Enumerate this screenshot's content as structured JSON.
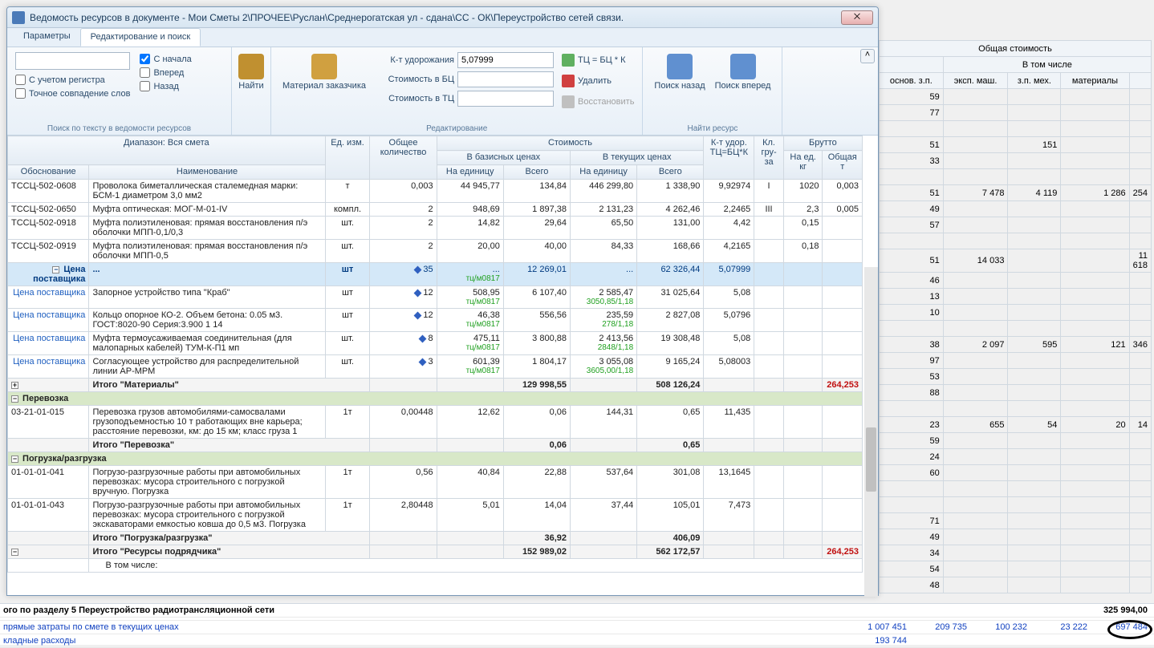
{
  "window": {
    "title": "Ведомость ресурсов в документе - Мои Сметы 2\\ПРОЧЕЕ\\Руслан\\Среднерогатская ул - сдана\\СС - ОК\\Переустройство сетей связи.",
    "close": "⨉"
  },
  "tabs": {
    "params": "Параметры",
    "edit": "Редактирование и поиск"
  },
  "ribbon": {
    "group1": "Поиск по тексту в ведомости ресурсов",
    "chk_register": "С учетом регистра",
    "chk_exact": "Точное совпадение слов",
    "chk_start": "С начала",
    "chk_fwd": "Вперед",
    "chk_back": "Назад",
    "find": "Найти",
    "material": "Материал заказчика",
    "k_label": "К-т удорожания",
    "k_val": "5,07999",
    "cost_bc": "Стоимость в БЦ",
    "cost_tc": "Стоимость в ТЦ",
    "group2": "Редактирование",
    "tcbc": "ТЦ = БЦ * К",
    "delete": "Удалить",
    "restore": "Восстановить",
    "group3": "Найти ресурс",
    "search_back": "Поиск назад",
    "search_fwd": "Поиск вперед"
  },
  "hdr": {
    "range": "Диапазон: Вся смета",
    "obosn": "Обоснование",
    "name": "Наименование",
    "unit": "Ед. изм.",
    "qty": "Общее количество",
    "cost": "Стоимость",
    "base": "В базисных ценах",
    "cur": "В текущих ценах",
    "per": "На единицу",
    "total": "Всего",
    "k": "К-т удор. ТЦ=БЦ*К",
    "class": "Кл. гру-за",
    "brutto": "Брутто",
    "brutto1": "На ед. кг",
    "brutto2": "Общая т"
  },
  "rows": [
    {
      "code": "ТССЦ-502-0608",
      "name": "Проволока биметаллическая сталемедная марки: БСМ-1 диаметром 3,0 мм2",
      "u": "т",
      "q": "0,003",
      "bp": "44 945,77",
      "bt": "134,84",
      "cp": "446 299,80",
      "ct": "1 338,90",
      "k": "9,92974",
      "cl": "I",
      "b1": "1020",
      "b2": "0,003"
    },
    {
      "code": "ТССЦ-502-0650",
      "name": "Муфта оптическая: МОГ-М-01-IV",
      "u": "компл.",
      "q": "2",
      "bp": "948,69",
      "bt": "1 897,38",
      "cp": "2 131,23",
      "ct": "4 262,46",
      "k": "2,2465",
      "cl": "III",
      "b1": "2,3",
      "b2": "0,005"
    },
    {
      "code": "ТССЦ-502-0918",
      "name": "Муфта полиэтиленовая: прямая восстановления п/э оболочки МПП-0,1/0,3",
      "u": "шт.",
      "q": "2",
      "bp": "14,82",
      "bt": "29,64",
      "cp": "65,50",
      "ct": "131,00",
      "k": "4,42",
      "cl": "",
      "b1": "0,15",
      "b2": ""
    },
    {
      "code": "ТССЦ-502-0919",
      "name": "Муфта полиэтиленовая: прямая восстановления п/э оболочки МПП-0,5",
      "u": "шт.",
      "q": "2",
      "bp": "20,00",
      "bt": "40,00",
      "cp": "84,33",
      "ct": "168,66",
      "k": "4,2165",
      "cl": "",
      "b1": "0,18",
      "b2": ""
    },
    {
      "sel": true,
      "code": "Цена поставщика",
      "name": "...",
      "u": "шт",
      "q": "35",
      "bp": "...",
      "bp2": "тц/м0817",
      "bt": "12 269,01",
      "cp": "...",
      "ct": "62 326,44",
      "k": "5,07999"
    },
    {
      "code": "Цена поставщика",
      "name": "Запорное устройство типа \"Краб\"",
      "u": "шт",
      "q": "12",
      "bp": "508,95",
      "bp2": "тц/м0817",
      "bt": "6 107,40",
      "cp": "2 585,47",
      "cp2": "3050,85/1,18",
      "ct": "31 025,64",
      "k": "5,08"
    },
    {
      "code": "Цена поставщика",
      "name": "Кольцо опорное КО-2. Объем бетона: 0.05 м3. ГОСТ:8020-90 Серия:3.900 1 14",
      "u": "шт",
      "q": "12",
      "bp": "46,38",
      "bp2": "тц/м0817",
      "bt": "556,56",
      "cp": "235,59",
      "cp2": "278/1,18",
      "ct": "2 827,08",
      "k": "5,0796"
    },
    {
      "code": "Цена поставщика",
      "name": "Муфта термоусаживаемая соединительная  (для малопарных кабелей) ТУМ-К-П1 мп",
      "u": "шт.",
      "q": "8",
      "bp": "475,11",
      "bp2": "тц/м0817",
      "bt": "3 800,88",
      "cp": "2 413,56",
      "cp2": "2848/1,18",
      "ct": "19 308,48",
      "k": "5,08"
    },
    {
      "code": "Цена поставщика",
      "name": "Согласующее устройство для распределительной линии АР-МРМ",
      "u": "шт.",
      "q": "3",
      "bp": "601,39",
      "bp2": "тц/м0817",
      "bt": "1 804,17",
      "cp": "3 055,08",
      "cp2": "3605,00/1,18",
      "ct": "9 165,24",
      "k": "5,08003"
    }
  ],
  "totals": {
    "mat": "Итого \"Материалы\"",
    "mat_bt": "129 998,55",
    "mat_ct": "508 126,24",
    "mat_b2": "264,253",
    "perev": "Перевозка",
    "r1_code": "03-21-01-015",
    "r1_name": "Перевозка грузов автомобилями-самосвалами грузоподъемностью 10 т работающих вне карьера; расстояние перевозки, км: до 15 км; класс груза 1",
    "r1_u": "1т",
    "r1_q": "0,00448",
    "r1_bp": "12,62",
    "r1_bt": "0,06",
    "r1_cp": "144,31",
    "r1_ct": "0,65",
    "r1_k": "11,435",
    "perev_tot": "Итого \"Перевозка\"",
    "perev_bt": "0,06",
    "perev_ct": "0,65",
    "pogr": "Погрузка/разгрузка",
    "p1_code": "01-01-01-041",
    "p1_name": "Погрузо-разгрузочные работы при автомобильных перевозках: мусора строительного с погрузкой вручную. Погрузка",
    "p1_u": "1т",
    "p1_q": "0,56",
    "p1_bp": "40,84",
    "p1_bt": "22,88",
    "p1_cp": "537,64",
    "p1_ct": "301,08",
    "p1_k": "13,1645",
    "p2_code": "01-01-01-043",
    "p2_name": "Погрузо-разгрузочные работы при автомобильных перевозках: мусора строительного с погрузкой экскаваторами емкостью ковша до 0,5 м3. Погрузка",
    "p2_u": "1т",
    "p2_q": "2,80448",
    "p2_bp": "5,01",
    "p2_bt": "14,04",
    "p2_cp": "37,44",
    "p2_ct": "105,01",
    "p2_k": "7,473",
    "pogr_tot": "Итого \"Погрузка/разгрузка\"",
    "pogr_bt": "36,92",
    "pogr_ct": "406,09",
    "res_tot": "Итого \"Ресурсы подрядчика\"",
    "res_bt": "152 989,02",
    "res_ct": "562 172,57",
    "res_b2": "264,253",
    "incl": "В том числе:"
  },
  "bg": {
    "h1": "Общая стоимость",
    "h2": "В том числе",
    "c1": "основ. з.п.",
    "c2": "эксп. маш.",
    "c3": "з.п. мех.",
    "c4": "материалы",
    "nums59": "59",
    "nums77": "77",
    "nums51": "51",
    "v151": "151",
    "nums33": "33",
    "r51": "51",
    "r51_1": "7 478",
    "r51_2": "4 119",
    "r51_3": "1 286",
    "r51_4": "254",
    "n49": "49",
    "n57": "57",
    "r51b": "51",
    "r51b_1": "14 033",
    "r51b_4": "11 618",
    "n46": "46",
    "n13": "13",
    "n10": "10",
    "r38": "38",
    "r38_1": "2 097",
    "r38_2": "595",
    "r38_3": "121",
    "r38_4": "346",
    "n97": "97",
    "n53": "53",
    "n88": "88",
    "r23": "23",
    "r23_1": "655",
    "r23_2": "54",
    "r23_3": "20",
    "r23_4": "14",
    "n59b": "59",
    "n24": "24",
    "n60": "60",
    "n71": "71",
    "n49b": "49",
    "n34": "34",
    "n54": "54",
    "n48": "48"
  },
  "footer": {
    "sec": "ого по разделу 5 Переустройство радиотрансляционной сети",
    "sec_v": "325 994,00",
    "direct": "прямые затраты по смете в текущих ценах",
    "d1": "1 007 451",
    "d2": "209 735",
    "d3": "100 232",
    "d4": "23 222",
    "d5": "697 484",
    "over": "кладные расходы",
    "over_v": "193 744"
  }
}
